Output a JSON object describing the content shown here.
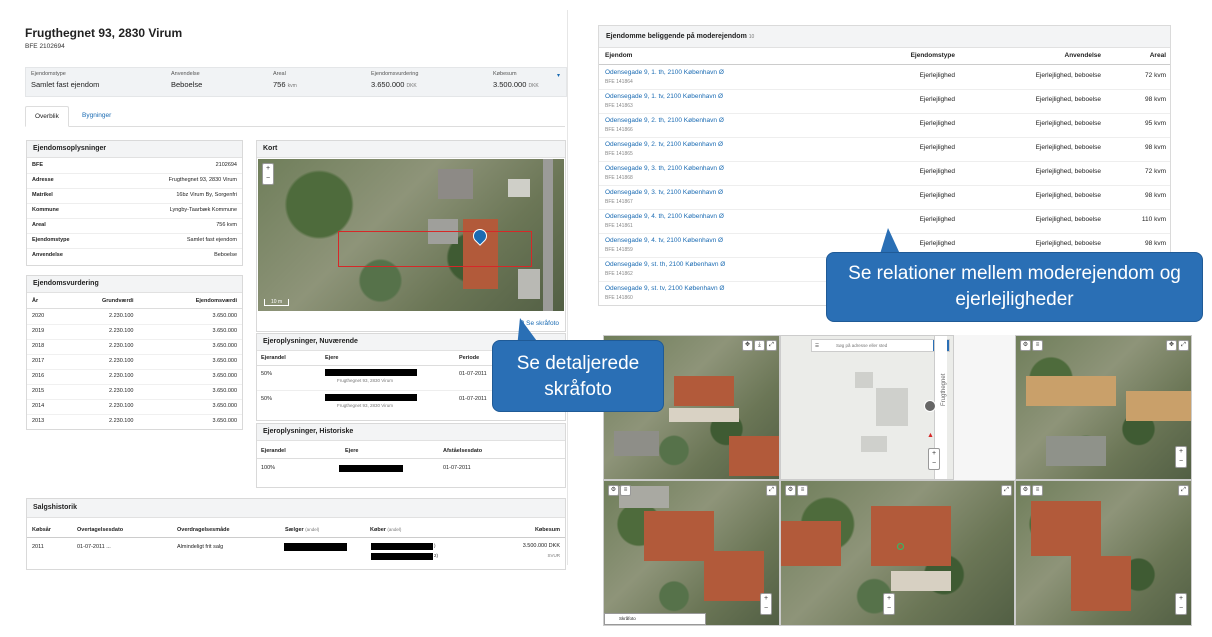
{
  "property": {
    "title": "Frugthegnet 93, 2830 Virum",
    "bfe_line": "BFE 2102694",
    "summary": {
      "type_label": "Ejendomstype",
      "type_value": "Samlet fast ejendom",
      "use_label": "Anvendelse",
      "use_value": "Beboelse",
      "area_label": "Areal",
      "area_value": "756",
      "area_unit": "kvm",
      "valuation_label": "Ejendomsvurdering",
      "valuation_value": "3.650.000",
      "valuation_unit": "DKK",
      "price_label": "Købesum",
      "price_value": "3.500.000",
      "price_unit": "DKK"
    },
    "tabs": [
      "Overblik",
      "Bygninger"
    ]
  },
  "info_card": {
    "title": "Ejendomsoplysninger",
    "rows": [
      {
        "k": "BFE",
        "v": "2102694"
      },
      {
        "k": "Adresse",
        "v": "Frugthegnet 93, 2830 Virum"
      },
      {
        "k": "Matrikel",
        "v": "16bz Virum By, Sorgenfri"
      },
      {
        "k": "Kommune",
        "v": "Lyngby-Taarbæk Kommune"
      },
      {
        "k": "Areal",
        "v": "756 kvm"
      },
      {
        "k": "Ejendomstype",
        "v": "Samlet fast ejendom"
      },
      {
        "k": "Anvendelse",
        "v": "Beboelse"
      }
    ]
  },
  "valuation_card": {
    "title": "Ejendomsvurdering",
    "headers": [
      "År",
      "Grundværdi",
      "Ejendomsværdi"
    ],
    "rows": [
      [
        "2020",
        "2.230.100",
        "3.650.000"
      ],
      [
        "2019",
        "2.230.100",
        "3.650.000"
      ],
      [
        "2018",
        "2.230.100",
        "3.650.000"
      ],
      [
        "2017",
        "2.230.100",
        "3.650.000"
      ],
      [
        "2016",
        "2.230.100",
        "3.650.000"
      ],
      [
        "2015",
        "2.230.100",
        "3.650.000"
      ],
      [
        "2014",
        "2.230.100",
        "3.650.000"
      ],
      [
        "2013",
        "2.230.100",
        "3.650.000"
      ]
    ]
  },
  "map_card": {
    "title": "Kort",
    "scale": "10 m",
    "link": "Se skråfoto",
    "zoom_in": "+",
    "zoom_out": "−"
  },
  "owners_current": {
    "title": "Ejeroplysninger, Nuværende",
    "headers": [
      "Ejerandel",
      "Ejere",
      "Periode"
    ],
    "rows": [
      {
        "share": "50%",
        "addr": "Frugthegnet 93, 2830 Virum",
        "period": "01-07-2011"
      },
      {
        "share": "50%",
        "addr": "Frugthegnet 93, 2830 Virum",
        "period": "01-07-2011"
      }
    ]
  },
  "owners_hist": {
    "title": "Ejeroplysninger, Historiske",
    "headers": [
      "Ejerandel",
      "Ejere",
      "Afståelsesdato"
    ],
    "rows": [
      {
        "share": "100%",
        "date": "01-07-2011"
      }
    ]
  },
  "sales": {
    "title": "Salgshistorik",
    "headers": [
      "Købsår",
      "Overtagelsesdato",
      "Overdragelsesmåde",
      "Sælger",
      "Køber",
      "Købesum"
    ],
    "seller_suffix": "(andel)",
    "buyer_suffix": "(andel)",
    "row": {
      "year": "2011",
      "date": "01-07-2011 ...",
      "method": "Almindeligt frit salg",
      "price": "3.500.000 DKK",
      "price_sub": "SVUR",
      "b1": ")",
      "b2": "2)"
    }
  },
  "related": {
    "title": "Ejendomme beliggende på moderejendom",
    "count": "10",
    "headers": [
      "Ejendom",
      "Ejendomstype",
      "Anvendelse",
      "Areal"
    ],
    "rows": [
      {
        "addr": "Odensegade 9, 1. th, 2100 København Ø",
        "bfe": "BFE 141864",
        "type": "Ejerlejlighed",
        "use": "Ejerlejlighed, beboelse",
        "area": "72 kvm"
      },
      {
        "addr": "Odensegade 9, 1. tv, 2100 København Ø",
        "bfe": "BFE 141863",
        "type": "Ejerlejlighed",
        "use": "Ejerlejlighed, beboelse",
        "area": "98 kvm"
      },
      {
        "addr": "Odensegade 9, 2. th, 2100 København Ø",
        "bfe": "BFE 141866",
        "type": "Ejerlejlighed",
        "use": "Ejerlejlighed, beboelse",
        "area": "95 kvm"
      },
      {
        "addr": "Odensegade 9, 2. tv, 2100 København Ø",
        "bfe": "BFE 141865",
        "type": "Ejerlejlighed",
        "use": "Ejerlejlighed, beboelse",
        "area": "98 kvm"
      },
      {
        "addr": "Odensegade 9, 3. th, 2100 København Ø",
        "bfe": "BFE 141868",
        "type": "Ejerlejlighed",
        "use": "Ejerlejlighed, beboelse",
        "area": "72 kvm"
      },
      {
        "addr": "Odensegade 9, 3. tv, 2100 København Ø",
        "bfe": "BFE 141867",
        "type": "Ejerlejlighed",
        "use": "Ejerlejlighed, beboelse",
        "area": "98 kvm"
      },
      {
        "addr": "Odensegade 9, 4. th, 2100 København Ø",
        "bfe": "BFE 141861",
        "type": "Ejerlejlighed",
        "use": "Ejerlejlighed, beboelse",
        "area": "110 kvm"
      },
      {
        "addr": "Odensegade 9, 4. tv, 2100 København Ø",
        "bfe": "BFE 141859",
        "type": "Ejerlejlighed",
        "use": "Ejerlejlighed, beboelse",
        "area": "98 kvm"
      },
      {
        "addr": "Odensegade 9, st. th, 2100 København Ø",
        "bfe": "BFE 141862",
        "type": "",
        "use": "",
        "area": ""
      },
      {
        "addr": "Odensegade 9, st. tv, 2100 København Ø",
        "bfe": "BFE 141860",
        "type": "",
        "use": "",
        "area": ""
      }
    ]
  },
  "callouts": {
    "relations": "Se relationer mellem moderejendom og ejerlejligheder",
    "oblique": "Se detaljerede skråfoto"
  },
  "oblique_viewer": {
    "search_placeholder": "Søg på adresse eller sted",
    "street_label": "Frugthegnet",
    "tile_label": "Skråfoto",
    "tile_text": "N"
  },
  "colors": {
    "accent": "#2a6fb5",
    "link": "#1a6bb3",
    "highlight": "#d62828"
  }
}
